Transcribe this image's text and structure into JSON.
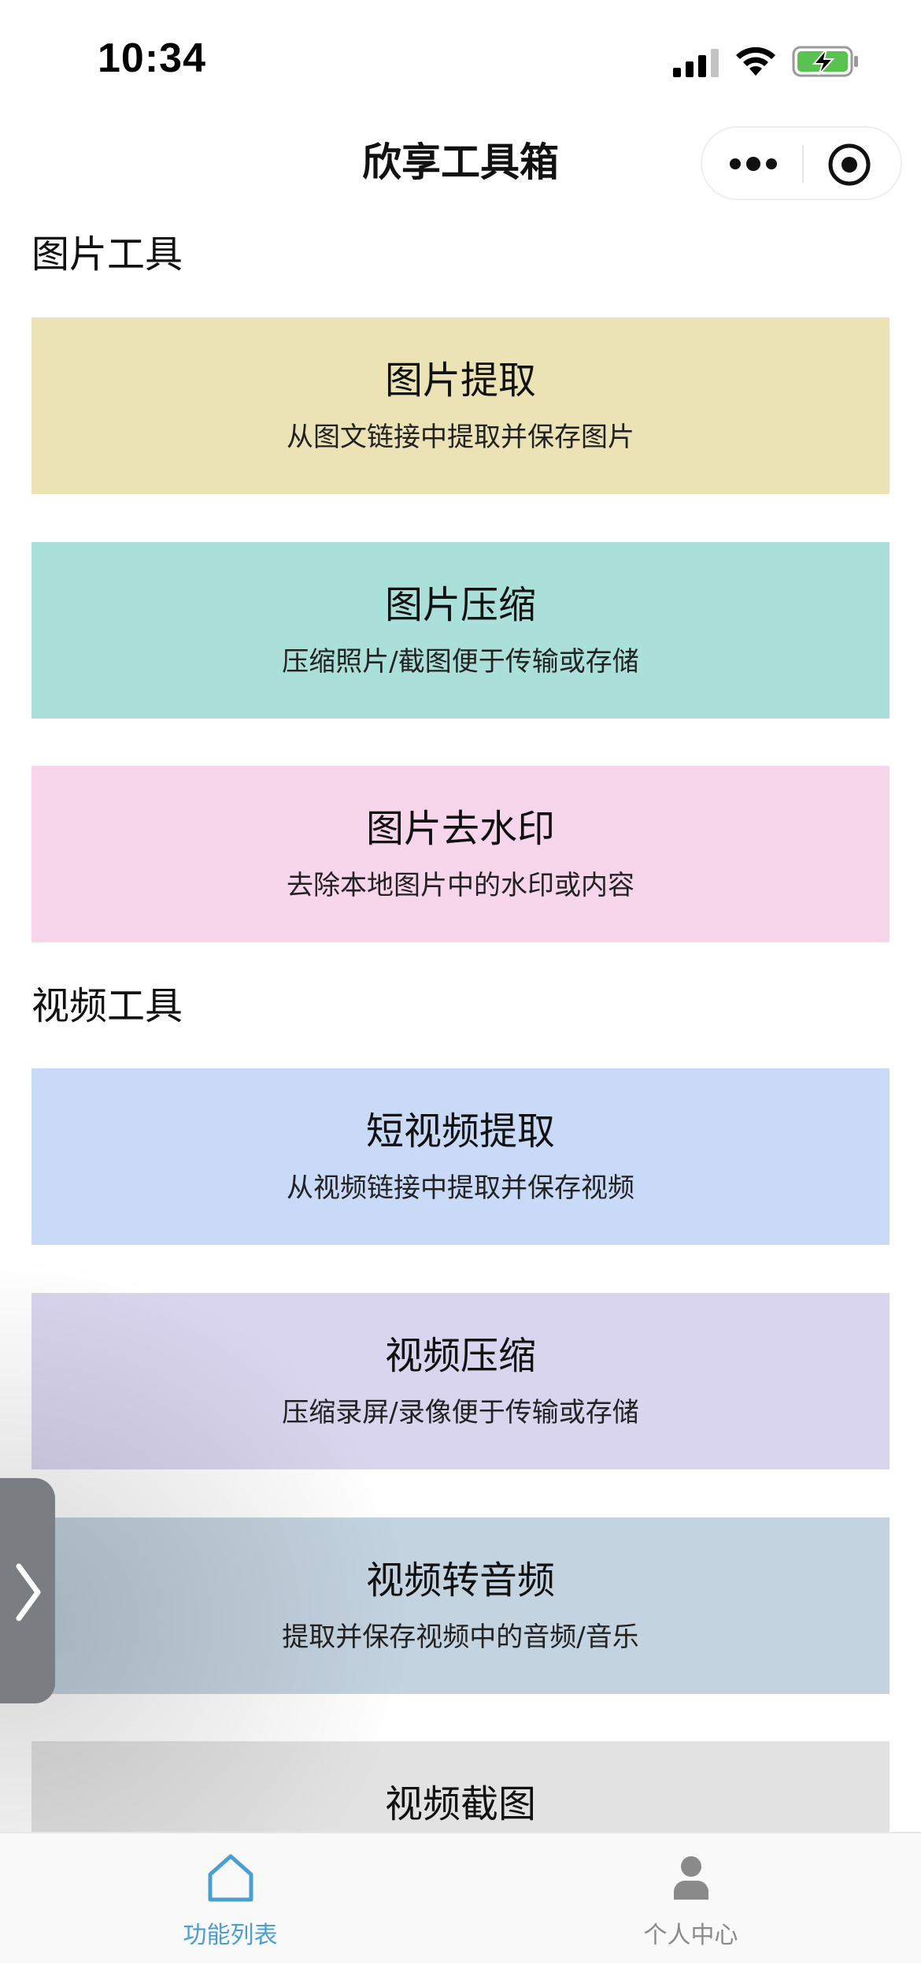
{
  "status_bar": {
    "time": "10:34"
  },
  "nav": {
    "title": "欣享工具箱"
  },
  "sections": [
    {
      "title": "图片工具",
      "tools": [
        {
          "title": "图片提取",
          "desc": "从图文链接中提取并保存图片",
          "color": "#ebe2b6"
        },
        {
          "title": "图片压缩",
          "desc": "压缩照片/截图便于传输或存储",
          "color": "#abe0da"
        },
        {
          "title": "图片去水印",
          "desc": "去除本地图片中的水印或内容",
          "color": "#f7d6ec"
        }
      ]
    },
    {
      "title": "视频工具",
      "tools": [
        {
          "title": "短视频提取",
          "desc": "从视频链接中提取并保存视频",
          "color": "#c8daf8"
        },
        {
          "title": "视频压缩",
          "desc": "压缩录屏/录像便于传输或存储",
          "color": "#d9d5ee"
        },
        {
          "title": "视频转音频",
          "desc": "提取并保存视频中的音频/音乐",
          "color": "#c3d3df"
        },
        {
          "title": "视频截图",
          "color": "#e2e2e2"
        }
      ]
    }
  ],
  "tab_bar": {
    "tabs": [
      {
        "label": "功能列表",
        "icon": "home-icon",
        "active": true,
        "color": "#4a9fd0"
      },
      {
        "label": "个人中心",
        "icon": "user-icon",
        "active": false,
        "color": "#8a8a8a"
      }
    ]
  },
  "colors": {
    "side_handle": "#7a7d82"
  }
}
